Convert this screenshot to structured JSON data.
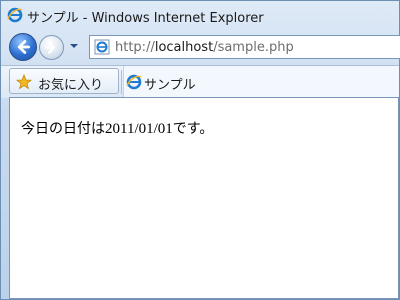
{
  "window": {
    "title": "サンプル - Windows Internet Explorer"
  },
  "nav": {
    "url_prefix": "http://",
    "url_host": "localhost",
    "url_path": "/sample.php"
  },
  "favorites": {
    "label": "お気に入り"
  },
  "tab": {
    "label": "サンプル"
  },
  "page": {
    "text_before": "今日の日付は",
    "date": "2011/01/01",
    "text_after": "です。"
  },
  "icons": {
    "browser": "ie-logo-icon",
    "back": "back-arrow-icon",
    "forward": "forward-arrow-icon",
    "favorites": "star-icon"
  },
  "colors": {
    "chrome": "#c7d9ee",
    "back_button": "#2f6fd1",
    "star": "#f2b824"
  }
}
